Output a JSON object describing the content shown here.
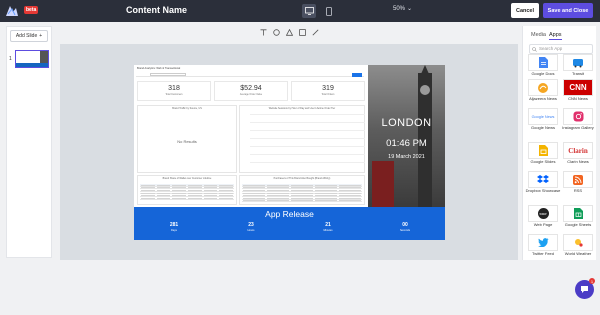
{
  "header": {
    "beta_badge": "beta",
    "title": "Content Name",
    "zoom": "50%",
    "cancel_label": "Cancel",
    "save_label": "Save and Close"
  },
  "slides_panel": {
    "add_slide_label": "Add Slide",
    "slides": [
      {
        "number": "1"
      }
    ]
  },
  "slide": {
    "dashboard": {
      "title": "Brand Analytics: Web & Transactional",
      "kpis": [
        {
          "value": "318",
          "label": "Total Customers"
        },
        {
          "value": "$52.94",
          "label": "Average Order Value"
        },
        {
          "value": "319",
          "label": "Total Orders"
        }
      ],
      "left_panel_title": "Brand Traffic by Source, US",
      "no_results": "No Results",
      "right_panel_title": "Website Sessions by Hour of Day and User Lifetime Order Tier",
      "bottom_left_title": "Brand Share of Wallet over Customer Lifetime",
      "bottom_right_title": "Purchasers of This Brand Also Bought (Brand Affinity)"
    },
    "clock": {
      "city": "LONDON",
      "time": "01:46 PM",
      "date": "19 March 2021"
    },
    "countdown": {
      "title": "App Release",
      "items": [
        {
          "value": "281",
          "label": "Days"
        },
        {
          "value": "23",
          "label": "Hours"
        },
        {
          "value": "21",
          "label": "Minutes"
        },
        {
          "value": "00",
          "label": "Seconds"
        }
      ]
    }
  },
  "apps_panel": {
    "tabs": [
      {
        "label": "Media",
        "active": false
      },
      {
        "label": "Apps",
        "active": true
      }
    ],
    "search_placeholder": "Search App",
    "apps": [
      {
        "name": "Google Docs",
        "icon": "google-docs-icon"
      },
      {
        "name": "Transit",
        "icon": "transit-icon"
      },
      {
        "name": "Aljazeera News",
        "icon": "aljazeera-icon"
      },
      {
        "name": "CNN News",
        "icon": "cnn-icon",
        "logo_text": "CNN"
      },
      {
        "name": "Google News",
        "icon": "google-news-icon",
        "logo_text": "Google News"
      },
      {
        "name": "Instagram Gallery",
        "icon": "instagram-icon"
      },
      {
        "name": "Google Slides",
        "icon": "google-slides-icon"
      },
      {
        "name": "Clarin News",
        "icon": "clarin-icon",
        "logo_text": "Clarin"
      },
      {
        "name": "Dropbox Showcase",
        "icon": "dropbox-icon"
      },
      {
        "name": "RSS",
        "icon": "rss-icon"
      },
      {
        "name": "Web Page",
        "icon": "www-icon",
        "logo_text": "www"
      },
      {
        "name": "Google Sheets",
        "icon": "google-sheets-icon"
      },
      {
        "name": "Twitter Feed",
        "icon": "twitter-icon"
      },
      {
        "name": "World Weather",
        "icon": "weather-icon"
      }
    ]
  },
  "chat": {
    "badge": "1"
  },
  "colors": {
    "accent": "#5d4de0",
    "topbar": "#2b2f3a",
    "countdown_bg": "#1565d8"
  }
}
